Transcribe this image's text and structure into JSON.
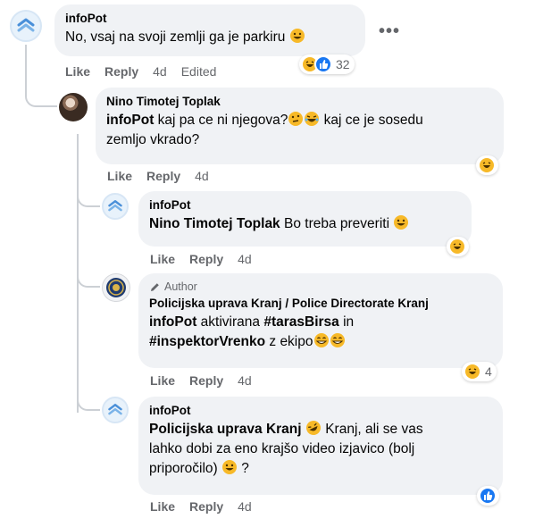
{
  "comments": [
    {
      "author": "infoPot",
      "text": "No, vsaj na svoji zemlji ga je parkiru",
      "actions": {
        "like": "Like",
        "reply": "Reply",
        "time": "4d",
        "edited": "Edited"
      },
      "reactions": {
        "count": "32",
        "types": [
          "haha",
          "like"
        ]
      }
    },
    {
      "author": "Nino Timotej Toplak",
      "mention": "infoPot",
      "text_1": " kaj pa ce ni njegova?",
      "text_2": " kaj ce je sosedu",
      "text_3": "zemljo vkrado?",
      "actions": {
        "like": "Like",
        "reply": "Reply",
        "time": "4d"
      },
      "reactions": {
        "types": [
          "haha"
        ]
      }
    },
    {
      "author": "infoPot",
      "mention": "Nino Timotej Toplak",
      "text": " Bo treba preveriti",
      "actions": {
        "like": "Like",
        "reply": "Reply",
        "time": "4d"
      },
      "reactions": {
        "types": [
          "haha"
        ]
      }
    },
    {
      "badge": "Author",
      "author": "Policijska uprava Kranj / Police Directorate Kranj",
      "mention": "infoPot",
      "text_1": " aktivirana ",
      "hashtag_1": "#tarasBirsa",
      "text_2": " in",
      "hashtag_2": "#inspektorVrenko",
      "text_3": " z ekipo",
      "actions": {
        "like": "Like",
        "reply": "Reply",
        "time": "4d"
      },
      "reactions": {
        "count": "4",
        "types": [
          "haha"
        ]
      }
    },
    {
      "author": "infoPot",
      "mention": "Policijska uprava Kranj",
      "text_1": " Kranj, ali se vas",
      "text_2": "lahko dobi za eno krajšo video izjavico (bolj",
      "text_3": "priporočilo)",
      "text_4": " ?",
      "actions": {
        "like": "Like",
        "reply": "Reply",
        "time": "4d"
      },
      "reactions": {
        "types": [
          "like"
        ]
      }
    }
  ],
  "more_options": "•••",
  "colors": {
    "accent": "#1877f2",
    "bubble": "#f0f2f5",
    "muted": "#65676b",
    "haha": "#f7b928"
  },
  "icons": [
    "infopot-logo-icon",
    "police-badge-icon",
    "pencil-icon",
    "haha-icon",
    "like-icon",
    "grin-icon",
    "thinking-icon",
    "more-horizontal-icon"
  ]
}
